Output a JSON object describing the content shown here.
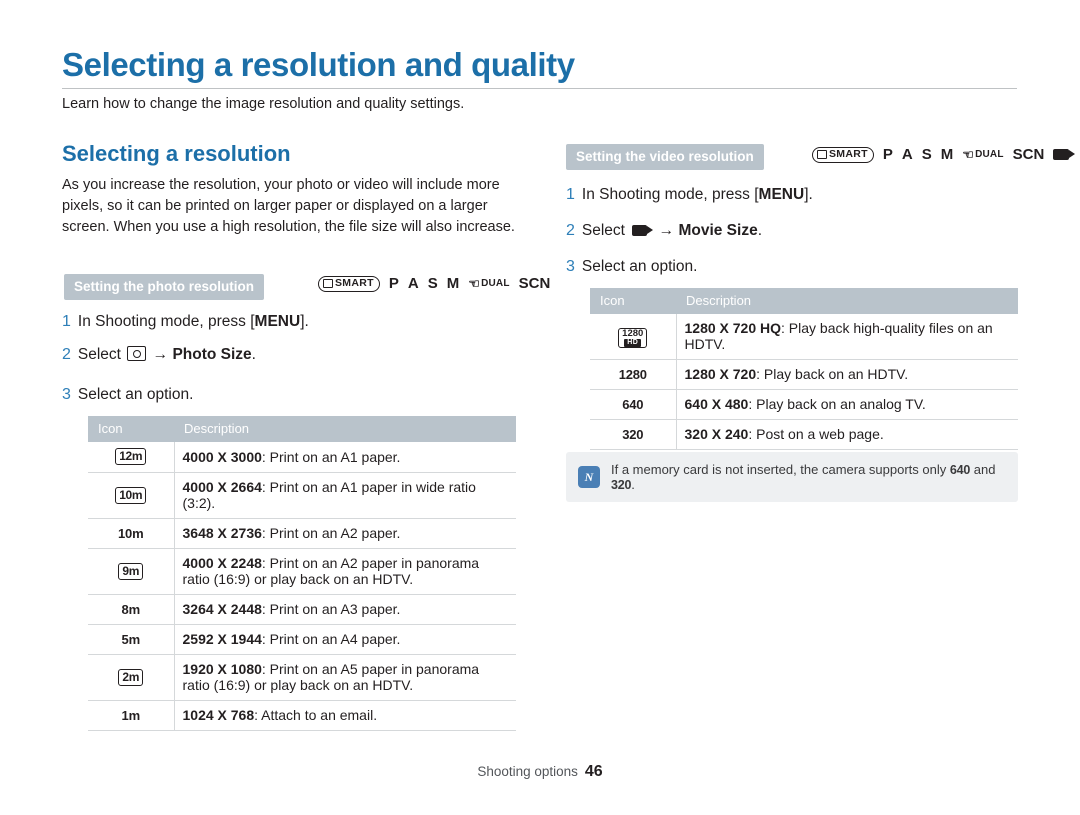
{
  "page": {
    "title": "Selecting a resolution and quality",
    "intro": "Learn how to change the image resolution and quality settings.",
    "footer_label": "Shooting options",
    "footer_page": "46"
  },
  "left": {
    "heading": "Selecting a resolution",
    "body": "As you increase the resolution, your photo or video will include more pixels, so it can be printed on larger paper or displayed on a larger screen. When you use a high resolution, the file size will also increase.",
    "subhead": "Setting the photo resolution",
    "modes": [
      "SMART",
      "P",
      "A",
      "S",
      "M",
      "DUAL",
      "SCN"
    ],
    "steps": [
      {
        "num": "1",
        "pre": "In Shooting mode, press [",
        "bold": "MENU",
        "post": "]."
      },
      {
        "num": "2",
        "pre": "Select",
        "icon": "photo-icon",
        "arrow": "→",
        "bold": "Photo Size",
        "post": "."
      },
      {
        "num": "3",
        "pre": "Select an option.",
        "bold": "",
        "post": ""
      }
    ],
    "table": {
      "headers": [
        "Icon",
        "Description"
      ],
      "rows": [
        {
          "icon": "12m",
          "size": "4000 X 3000",
          "desc": ": Print on an A1 paper."
        },
        {
          "icon": "10m",
          "size": "4000 X 2664",
          "desc": ": Print on an A1 paper in wide ratio (3:2)."
        },
        {
          "icon": "10m",
          "size": "3648 X 2736",
          "desc": ": Print on an A2 paper."
        },
        {
          "icon": "9m",
          "size": "4000 X 2248",
          "desc": ": Print on an A2 paper in panorama ratio (16:9) or play back on an HDTV."
        },
        {
          "icon": "8m",
          "size": "3264 X 2448",
          "desc": ": Print on an A3 paper."
        },
        {
          "icon": "5m",
          "size": "2592 X 1944",
          "desc": ": Print on an A4 paper."
        },
        {
          "icon": "2m",
          "size": "1920 X 1080",
          "desc": ": Print on an A5 paper in panorama ratio (16:9) or play back on an HDTV."
        },
        {
          "icon": "1m",
          "size": "1024 X 768",
          "desc": ": Attach to an email."
        }
      ]
    }
  },
  "right": {
    "subhead": "Setting the video resolution",
    "modes": [
      "SMART",
      "P",
      "A",
      "S",
      "M",
      "DUAL",
      "SCN",
      "video-icon"
    ],
    "steps": [
      {
        "num": "1",
        "pre": "In Shooting mode, press [",
        "bold": "MENU",
        "post": "]."
      },
      {
        "num": "2",
        "pre": "Select",
        "icon": "video-icon",
        "arrow": "→",
        "bold": "Movie Size",
        "post": "."
      },
      {
        "num": "3",
        "pre": "Select an option.",
        "bold": "",
        "post": ""
      }
    ],
    "table": {
      "headers": [
        "Icon",
        "Description"
      ],
      "rows": [
        {
          "icon": "1280 HD",
          "size": "1280 X 720 HQ",
          "desc": ": Play back high-quality files on an HDTV."
        },
        {
          "icon": "1280",
          "size": "1280 X 720",
          "desc": ": Play back on an HDTV."
        },
        {
          "icon": "640",
          "size": "640 X 480",
          "desc": ": Play back on an analog TV."
        },
        {
          "icon": "320",
          "size": "320 X 240",
          "desc": ": Post on a web page."
        }
      ]
    },
    "note": {
      "icon_label": "N",
      "text_pre": "If a memory card is not inserted, the camera supports only",
      "val1": "640",
      "mid": "and",
      "val2": "320",
      "text_post": "."
    }
  }
}
